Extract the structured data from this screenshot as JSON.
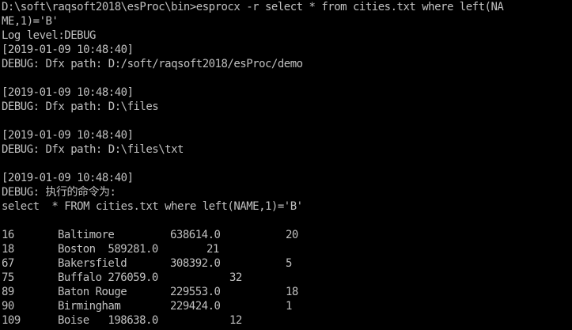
{
  "console": {
    "lines": [
      "D:\\soft\\raqsoft2018\\esProc\\bin>esprocx -r select * from cities.txt where left(NA",
      "ME,1)='B'",
      "Log level:DEBUG",
      "[2019-01-09 10:48:40]",
      "DEBUG: Dfx path: D:/soft/raqsoft2018/esProc/demo",
      "",
      "[2019-01-09 10:48:40]",
      "DEBUG: Dfx path: D:\\files",
      "",
      "[2019-01-09 10:48:40]",
      "DEBUG: Dfx path: D:\\files\\txt",
      "",
      "[2019-01-09 10:48:40]",
      "DEBUG: 执行的命令为:",
      "select  * FROM cities.txt where left(NAME,1)='B'",
      ""
    ],
    "rows": [
      {
        "id": "16",
        "name": "Baltimore",
        "pop": "638614.0",
        "rank": "20"
      },
      {
        "id": "18",
        "name": "Boston  589281.0",
        "pop": "",
        "rank": "21"
      },
      {
        "id": "67",
        "name": "Bakersfield",
        "pop": "308392.0",
        "rank": "5"
      },
      {
        "id": "75",
        "name": "Buffalo 276059.0",
        "pop": "",
        "rank": "32"
      },
      {
        "id": "89",
        "name": "Baton Rouge",
        "pop": "229553.0",
        "rank": "18"
      },
      {
        "id": "90",
        "name": "Birmingham",
        "pop": "229424.0",
        "rank": "1"
      },
      {
        "id": "109",
        "name": "Boise   198638.0",
        "pop": "",
        "rank": "12"
      }
    ]
  },
  "colors": {
    "background": "#000000",
    "text": "#c0c0c0"
  }
}
